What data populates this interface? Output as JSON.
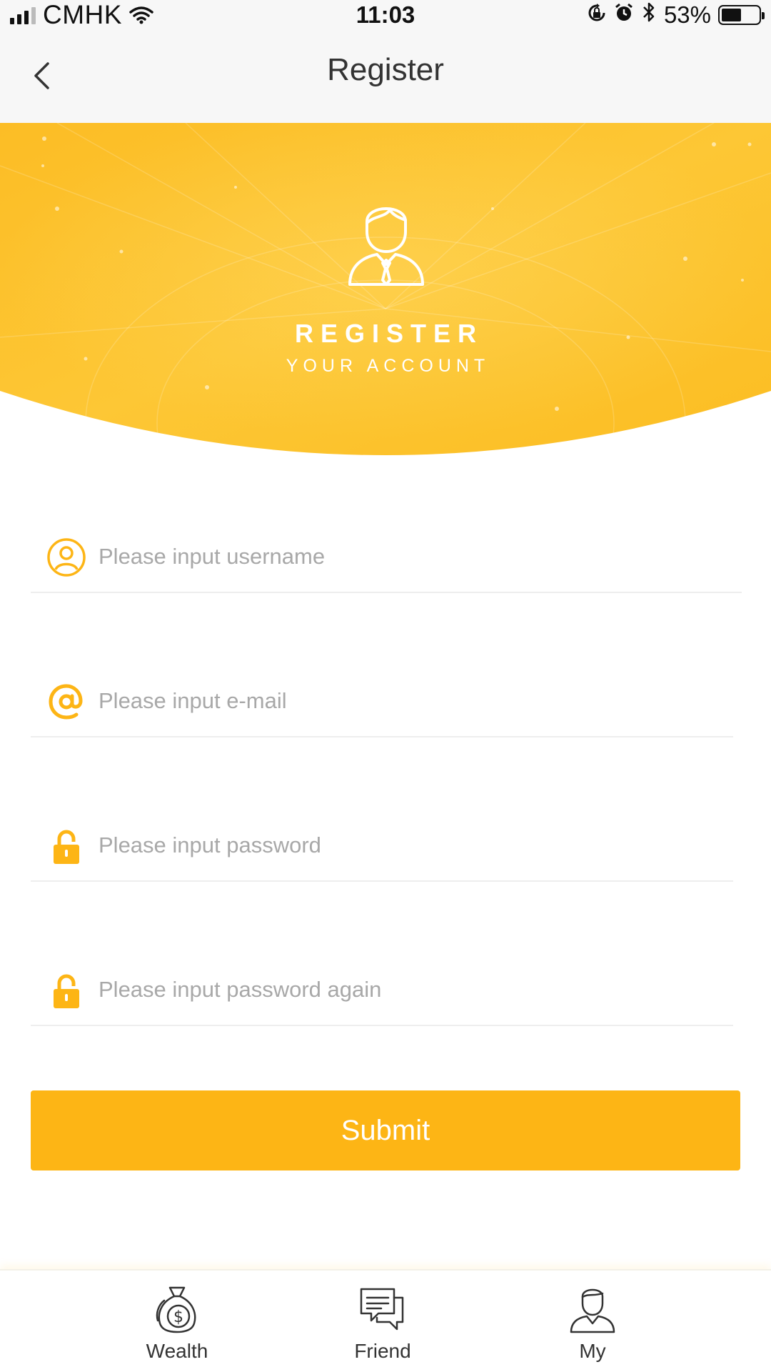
{
  "status_bar": {
    "carrier": "CMHK",
    "time": "11:03",
    "battery": "53%",
    "battery_level": 0.53,
    "icons": [
      "signal-icon",
      "wifi-icon",
      "orientation-lock-icon",
      "alarm-icon",
      "bluetooth-icon",
      "battery-icon"
    ]
  },
  "nav": {
    "title": "Register",
    "back_icon": "chevron-left-icon"
  },
  "hero": {
    "title": "REGISTER",
    "subtitle": "YOUR ACCOUNT",
    "icon": "businessman-avatar-icon"
  },
  "form": {
    "fields": [
      {
        "icon": "user-circle-icon",
        "placeholder": "Please input username",
        "value": ""
      },
      {
        "icon": "at-sign-icon",
        "placeholder": "Please input e-mail",
        "value": ""
      },
      {
        "icon": "lock-icon",
        "placeholder": "Please input password",
        "value": ""
      },
      {
        "icon": "lock-icon",
        "placeholder": "Please input password again",
        "value": ""
      }
    ],
    "submit_label": "Submit"
  },
  "tabs": [
    {
      "label": "Wealth",
      "icon": "money-bag-icon"
    },
    {
      "label": "Friend",
      "icon": "chat-bubbles-icon"
    },
    {
      "label": "My",
      "icon": "user-profile-icon"
    }
  ],
  "colors": {
    "accent": "#fdb515",
    "hero_yellow": "#fcc02b",
    "text_dark": "#333333",
    "placeholder": "#a8a8a8",
    "divider": "#eeeeee"
  }
}
